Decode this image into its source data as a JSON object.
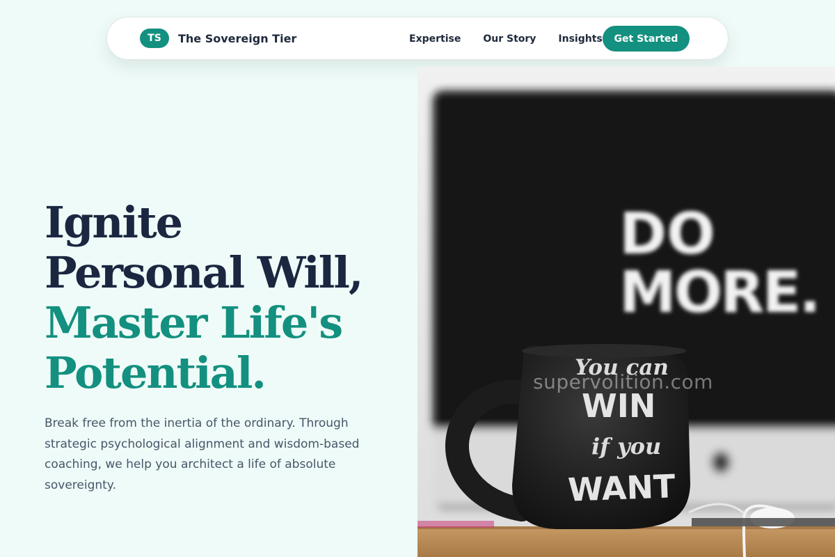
{
  "nav": {
    "brand_initials": "TS",
    "brand_name": "The Sovereign Tier",
    "links": [
      "Expertise",
      "Our Story",
      "Insights"
    ],
    "cta_label": "Get Started"
  },
  "hero": {
    "headline_line1": "Ignite",
    "headline_line2": "Personal Will,",
    "headline_line3": "Master Life's",
    "headline_line4": "Potential.",
    "subcopy": "Break free from the inertia of the ordinary. Through strategic psychological alignment and wisdom-based coaching, we help you architect a life of absolute sovereignty.",
    "image": {
      "screen_text_1": "DO",
      "screen_text_2": "MORE.",
      "mug_text_1": "You can",
      "mug_text_2": "WIN",
      "mug_text_3": "if you",
      "mug_text_4": "WANT"
    },
    "watermark": "supervolition.com"
  },
  "colors": {
    "background": "#effbf8",
    "accent": "#13907f",
    "heading": "#1b2740",
    "body_text": "#475569"
  }
}
